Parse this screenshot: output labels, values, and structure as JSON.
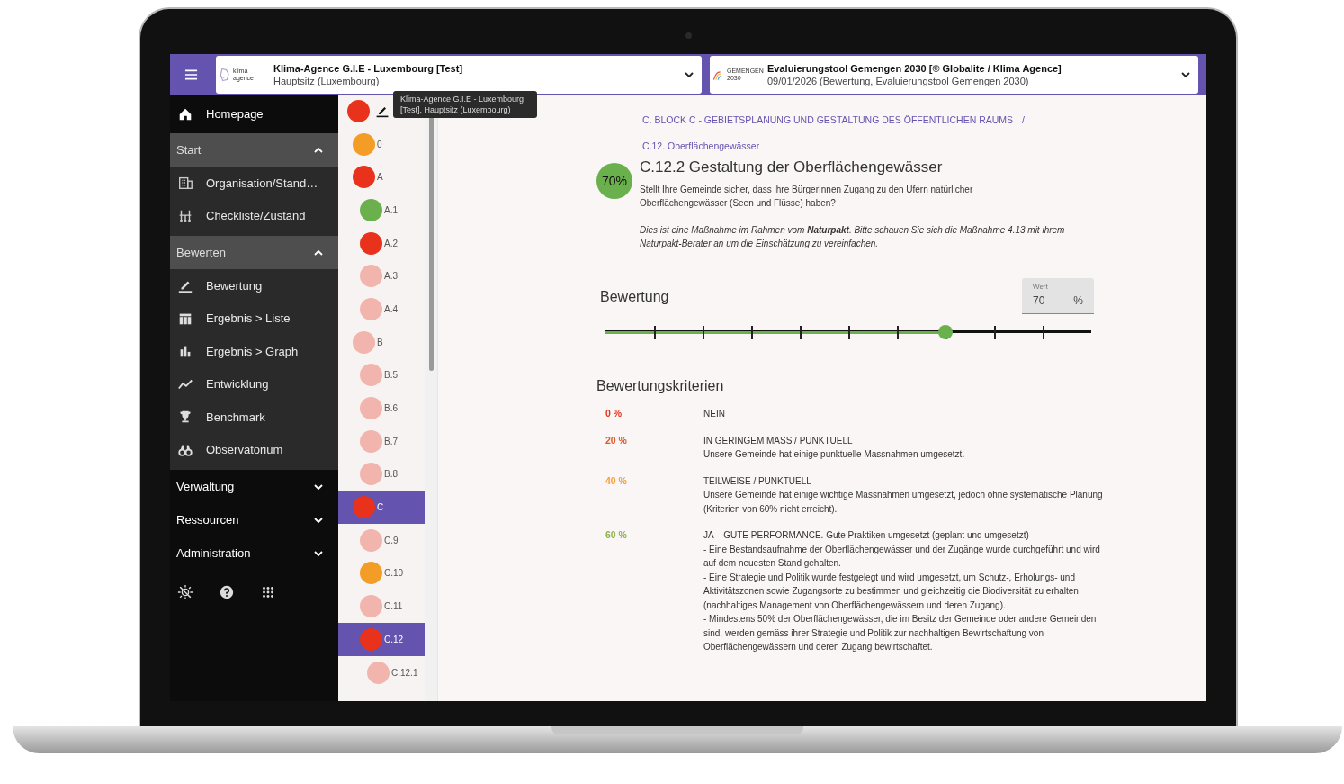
{
  "topbar": {
    "org_selector": {
      "logo_text": "klima agence",
      "title": "Klima-Agence G.I.E - Luxembourg [Test]",
      "subtitle": "Hauptsitz (Luxembourg)"
    },
    "eval_selector": {
      "logo_text": "GEMENGEN 2030",
      "title": "Evaluierungstool Gemengen 2030 [© Globalite / Klima Agence]",
      "subtitle": "09/01/2026 (Bewertung, Evaluierungstool Gemengen 2030)"
    }
  },
  "tooltip": "Klima-Agence G.I.E - Luxembourg [Test], Hauptsitz (Luxembourg)",
  "sidebar": {
    "items": [
      {
        "kind": "link",
        "label": "Homepage"
      },
      {
        "kind": "section",
        "label": "Start",
        "expanded": true,
        "children": [
          {
            "kind": "link",
            "label": "Organisation/Stand…"
          },
          {
            "kind": "link",
            "label": "Checkliste/Zustand"
          }
        ]
      },
      {
        "kind": "section",
        "label": "Bewerten",
        "expanded": true,
        "children": [
          {
            "kind": "link",
            "label": "Bewertung"
          },
          {
            "kind": "link",
            "label": "Ergebnis > Liste"
          },
          {
            "kind": "link",
            "label": "Ergebnis > Graph"
          },
          {
            "kind": "link",
            "label": "Entwicklung"
          },
          {
            "kind": "link",
            "label": "Benchmark"
          },
          {
            "kind": "link",
            "label": "Observatorium"
          }
        ]
      },
      {
        "kind": "section",
        "label": "Verwaltung",
        "expanded": false
      },
      {
        "kind": "section",
        "label": "Ressourcen",
        "expanded": false
      },
      {
        "kind": "section",
        "label": "Administration",
        "expanded": false
      }
    ]
  },
  "tree": {
    "color": "#e8321c",
    "selected": false,
    "children": [
      {
        "label": "0",
        "color": "#f39c26",
        "selected": false
      },
      {
        "label": "A",
        "color": "#e8321c",
        "selected": false,
        "children": [
          {
            "label": "A.1",
            "color": "#6ab04c",
            "selected": false
          },
          {
            "label": "A.2",
            "color": "#e8321c",
            "selected": false
          },
          {
            "label": "A.3",
            "color": "#f2b5ad",
            "selected": false
          },
          {
            "label": "A.4",
            "color": "#f2b5ad",
            "selected": false
          }
        ]
      },
      {
        "label": "B",
        "color": "#f2b5ad",
        "selected": false,
        "children": [
          {
            "label": "B.5",
            "color": "#f2b5ad",
            "selected": false
          },
          {
            "label": "B.6",
            "color": "#f2b5ad",
            "selected": false
          },
          {
            "label": "B.7",
            "color": "#f2b5ad",
            "selected": false
          },
          {
            "label": "B.8",
            "color": "#f2b5ad",
            "selected": false
          }
        ]
      },
      {
        "label": "C",
        "color": "#e8321c",
        "selected": true,
        "children": [
          {
            "label": "C.9",
            "color": "#f2b5ad",
            "selected": false
          },
          {
            "label": "C.10",
            "color": "#f39c26",
            "selected": false
          },
          {
            "label": "C.11",
            "color": "#f2b5ad",
            "selected": false
          },
          {
            "label": "C.12",
            "color": "#e8321c",
            "selected": true,
            "children": [
              {
                "label": "C.12.1",
                "color": "#f2b5ad",
                "selected": false
              }
            ]
          }
        ]
      }
    ]
  },
  "content": {
    "breadcrumb": [
      "C. BLOCK C - GEBIETSPLANUNG UND GESTALTUNG DES ÖFFENTLICHEN RAUMS",
      "/"
    ],
    "subtitle": "C.12. Oberflächengewässer",
    "badge": "70%",
    "title": "C.12.2 Gestaltung der Oberflächengewässer",
    "question": "Stellt Ihre Gemeinde sicher, dass ihre BürgerInnen Zugang zu den Ufern natürlicher Oberflächengewässer (Seen und Flüsse) haben?",
    "note": "Dies ist eine Maßnahme im Rahmen vom **Naturpakt**. Bitte schauen Sie sich die Maßnahme 4.13 mit ihrem Naturpakt-Berater an um die Einschätzung zu vereinfachen.",
    "rating": {
      "heading": "Bewertung",
      "level": 0.7,
      "field_label": "Wert",
      "value": "70",
      "unit": "%"
    },
    "criteria_heading": "Bewertungskriterien",
    "criteria": [
      {
        "percent": "0 %",
        "color": "#e8321c",
        "title": "NEIN"
      },
      {
        "percent": "20 %",
        "color": "#e0572c",
        "title": "IN GERINGEM MASS / PUNKTUELL",
        "text": "Unsere Gemeinde hat einige punktuelle Massnahmen umgesetzt."
      },
      {
        "percent": "40 %",
        "color": "#f0a03c",
        "title": "TEILWEISE / PUNKTUELL",
        "text": "Unsere Gemeinde hat einige wichtige Massnahmen umgesetzt, jedoch ohne systematische Planung (Kriterien von 60% nicht erreicht)."
      },
      {
        "percent": "60 %",
        "color": "#8db34a",
        "title": "JA – GUTE PERFORMANCE. Gute Praktiken umgesetzt (geplant und umgesetzt)",
        "text": "- Eine Bestandsaufnahme der Oberflächengewässer und der Zugänge wurde durchgeführt und wird auf dem neuesten Stand gehalten.\n- Eine Strategie und Politik wurde festgelegt und wird umgesetzt, um Schutz-, Erholungs- und Aktivitätszonen sowie Zugangsorte zu bestimmen und gleichzeitig die Biodiversität zu erhalten (nachhaltiges Management von Oberflächengewässern und deren Zugang).\n- Mindestens 50% der Oberflächengewässer, die im Besitz der Gemeinde oder andere Gemeinden sind, werden gemäss ihrer Strategie und Politik zur nachhaltigen Bewirtschaftung von Oberflächengewässern und deren Zugang bewirtschaftet."
      }
    ]
  }
}
